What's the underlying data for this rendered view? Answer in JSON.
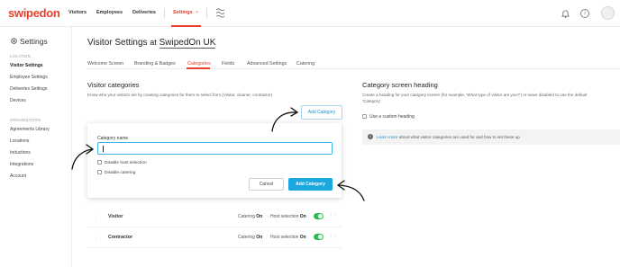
{
  "brand": {
    "logo_text": "swipedon",
    "accent_color": "#e8402f",
    "primary_button_color": "#1ba8e0",
    "toggle_on_color": "#2ebc4f"
  },
  "topnav": {
    "items": [
      "Visitors",
      "Employees",
      "Deliveries"
    ],
    "settings_label": "Settings",
    "icons": [
      "flag-icon",
      "bell-icon",
      "info-icon",
      "avatar"
    ]
  },
  "sidebar": {
    "title": "Settings",
    "location_header": "LOCATION",
    "location_items": [
      "Visitor Settings",
      "Employee Settings",
      "Deliveries Settings",
      "Devices"
    ],
    "organization_header": "ORGANIZATION",
    "organization_items": [
      "Agreements Library",
      "Locations",
      "Inductions",
      "Integrations",
      "Account"
    ]
  },
  "page": {
    "title_prefix": "Visitor Settings",
    "title_at": "at",
    "location_name": "SwipedOn UK",
    "tabs": [
      "Welcome Screen",
      "Branding & Badges",
      "Categories",
      "Fields",
      "Advanced Settings",
      "Catering"
    ],
    "active_tab": "Categories"
  },
  "visitor_categories": {
    "title": "Visitor categories",
    "description": "Know who your visitors are by creating categories for them to select from (Visitor, cleaner, contractor)",
    "add_button": "Add Category"
  },
  "modal": {
    "field_label": "Category name",
    "field_value": "",
    "checkbox_host": "Disable host selection",
    "checkbox_catering": "Disable catering",
    "cancel_label": "Cancel",
    "submit_label": "Add Category"
  },
  "categories": [
    {
      "name": "Visitor",
      "catering_label": "Catering",
      "catering_value": "On",
      "host_label": "Host selection",
      "host_value": "On"
    },
    {
      "name": "Contractor",
      "catering_label": "Catering",
      "catering_value": "On",
      "host_label": "Host selection",
      "host_value": "On"
    }
  ],
  "category_screen": {
    "title": "Category screen heading",
    "description_line1": "Create a heading for your category screen (for example, 'What type of visitor are you?') or leave disabled to use the default",
    "description_line2": "'Category'",
    "checkbox_label": "Use a custom heading",
    "info_link": "Learn more",
    "info_text": "about what visitor categories are used for and how to set these up"
  }
}
